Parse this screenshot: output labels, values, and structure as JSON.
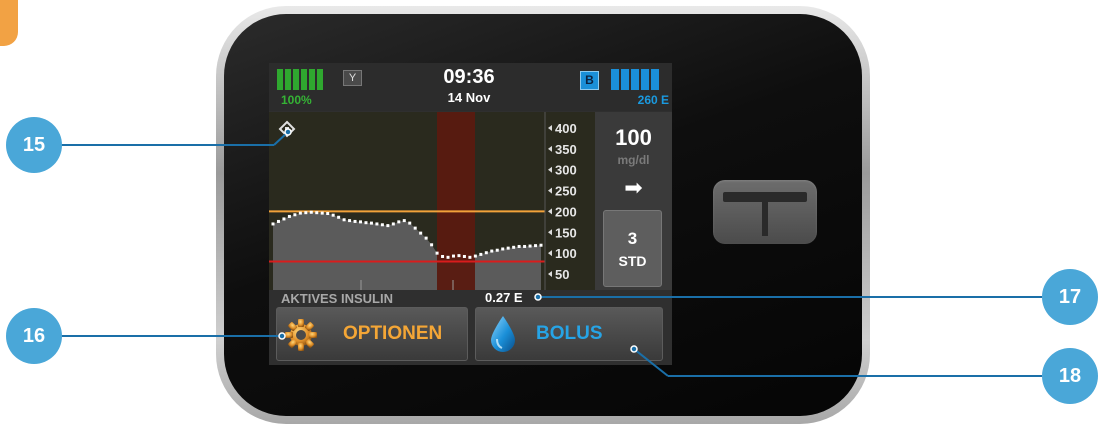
{
  "status_bar": {
    "battery_percent": "100%",
    "battery_level": 1.0,
    "signal_icon": "antenna-icon",
    "signal_glyph": "Y",
    "time": "09:36",
    "date": "14 Nov",
    "basal_badge": "B",
    "insulin_units": "260 E",
    "insulin_level": 1.0
  },
  "cgm_chart": {
    "y_ticks": [
      "400",
      "350",
      "300",
      "250",
      "200",
      "150",
      "100",
      "50"
    ],
    "high_threshold": 200,
    "low_threshold": 80,
    "colors": {
      "high_line": "#f2a23a",
      "low_line": "#d91c1c",
      "highlight_band": "#5a1a10",
      "trace": "#ffffff",
      "fill": "#5b5b5b"
    }
  },
  "chart_data": {
    "type": "line",
    "title": "",
    "xlabel": "",
    "ylabel": "",
    "ylim": [
      40,
      420
    ],
    "y_ticks": [
      400,
      350,
      300,
      250,
      200,
      150,
      100,
      50
    ],
    "thresholds": {
      "high": 200,
      "low": 80
    },
    "series": [
      {
        "values": [
          170,
          176,
          182,
          188,
          192,
          196,
          197,
          198,
          197,
          196,
          195,
          191,
          186,
          180,
          178,
          176,
          175,
          173,
          172,
          170,
          168,
          166,
          170,
          175,
          178,
          172,
          160,
          148,
          136,
          120,
          100,
          92,
          90,
          93,
          94,
          92,
          90,
          93,
          97,
          101,
          105,
          107,
          110,
          112,
          114,
          116,
          116,
          117,
          118,
          119
        ]
      }
    ]
  },
  "glucose": {
    "value": "100",
    "unit": "mg/dl",
    "trend_icon": "arrow-right-icon",
    "trend_glyph": "➡"
  },
  "profile": {
    "number": "3",
    "label": "STD"
  },
  "active_insulin": {
    "label": "AKTIVES INSULIN",
    "value": "0.27 E"
  },
  "buttons": {
    "options_label": "OPTIONEN",
    "bolus_label": "BOLUS"
  },
  "callouts": [
    "15",
    "16",
    "17",
    "18"
  ]
}
